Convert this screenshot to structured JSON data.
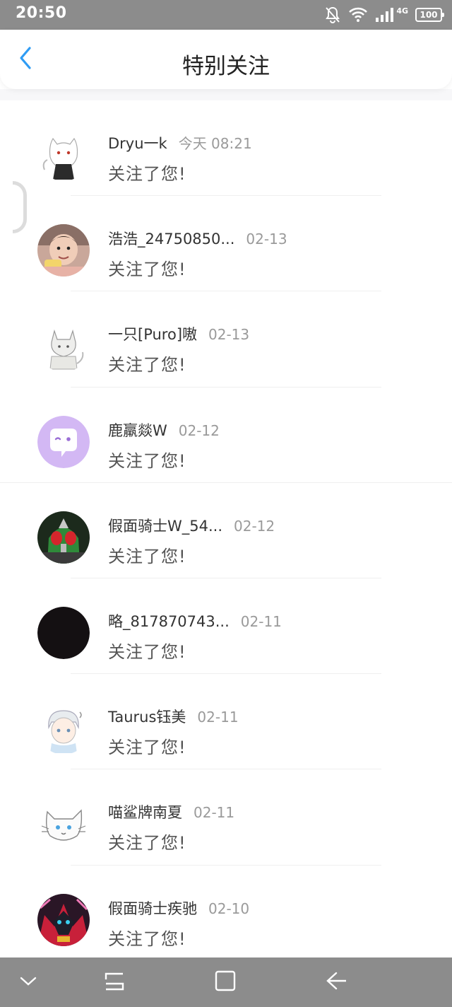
{
  "status_bar": {
    "time": "20:50",
    "network": "4G",
    "battery": "100",
    "icons": [
      "bell-off-icon",
      "wifi-icon",
      "signal-icon",
      "battery-icon"
    ]
  },
  "header": {
    "title": "特别关注",
    "back_icon": "chevron-left-icon",
    "accent_color": "#2f9cf4"
  },
  "list": {
    "items": [
      {
        "name": "Dryu一k",
        "time": "今天 08:21",
        "message": "关注了您!",
        "avatar": "white-wolf-drawing"
      },
      {
        "name": "浩浩_24750850...",
        "time": "02-13",
        "message": "关注了您!",
        "avatar": "child-photo"
      },
      {
        "name": "一只[Puro]嗷",
        "time": "02-13",
        "message": "关注了您!",
        "avatar": "gray-wolf-sketch"
      },
      {
        "name": "鹿羸燚W",
        "time": "02-12",
        "message": "关注了您!",
        "avatar": "purple-chat-bubble"
      },
      {
        "name": "假面骑士W_54...",
        "time": "02-12",
        "message": "关注了您!",
        "avatar": "kamen-rider-w"
      },
      {
        "name": "略_817870743...",
        "time": "02-11",
        "message": "关注了您!",
        "avatar": "black-circle"
      },
      {
        "name": "Taurus钰美",
        "time": "02-11",
        "message": "关注了您!",
        "avatar": "anime-boy"
      },
      {
        "name": "喵鲨牌南夏",
        "time": "02-11",
        "message": "关注了您!",
        "avatar": "white-cat-sketch"
      },
      {
        "name": "假面骑士疾驰",
        "time": "02-10",
        "message": "关注了您!",
        "avatar": "kamen-rider-red"
      }
    ]
  },
  "nav_bar": {
    "icons": [
      "chevron-down-icon",
      "recent-apps-icon",
      "home-icon",
      "back-arrow-icon"
    ]
  },
  "colors": {
    "status_bar": "#8c8c8c",
    "nav_bar": "#8c8c8c",
    "avatar_purple": "#d3b8f4",
    "timestamp": "#9a9a9a"
  }
}
